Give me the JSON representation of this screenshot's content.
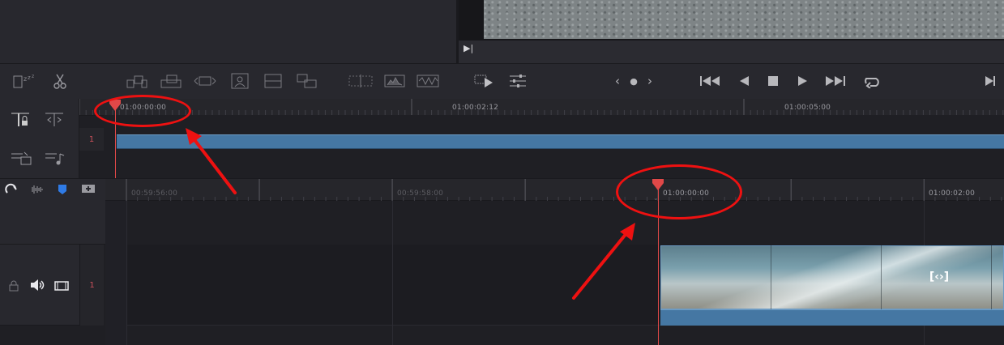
{
  "viewer": {
    "mark_button_icon": "play-to-end-icon"
  },
  "toolbar": {
    "left_tools": [
      "snoozing-icon",
      "scissors-icon"
    ],
    "edit_tools": [
      "insert-icon",
      "overwrite-icon",
      "replace-icon",
      "place-on-top-icon",
      "append-icon",
      "ripple-overwrite-icon"
    ],
    "view_tools": [
      "split-view-icon",
      "waveform-view-icon",
      "levels-view-icon"
    ],
    "viewer_tools": [
      "play-clip-icon",
      "sliders-icon"
    ],
    "jog": {
      "left": "‹",
      "dot": "●",
      "right": "›"
    },
    "transport": {
      "first": "⏮",
      "reverse": "◀",
      "stop": "■",
      "play": "▶",
      "last": "⏭",
      "loop": "⟲",
      "end": "▶|"
    }
  },
  "mini_timeline": {
    "timecodes": [
      "01:00:00:00",
      "01:00:02:12",
      "01:00:05:00"
    ],
    "track_number": "1"
  },
  "main_timeline": {
    "timecodes": [
      "00:59:56:00",
      "00:59:58:00",
      "01:00:00:00",
      "01:00:02:00"
    ],
    "track_number": "1",
    "trim_icon": "[‹›]"
  },
  "colors": {
    "accent_playhead": "#e04848",
    "clip_blue": "#4577a3",
    "annotation_red": "#ee1111"
  }
}
